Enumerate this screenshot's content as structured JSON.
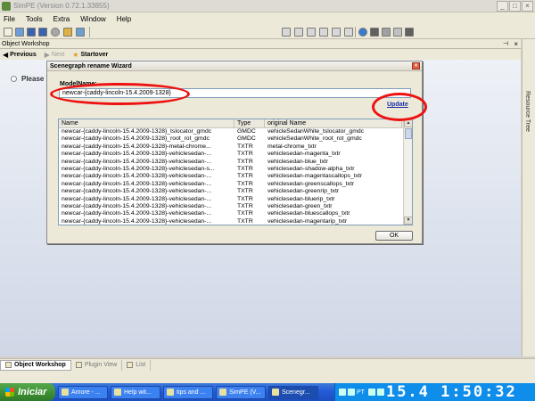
{
  "window": {
    "title": "SimPE (Version 0.72.1.33855)"
  },
  "menu": {
    "items": [
      "File",
      "Tools",
      "Extra",
      "Window",
      "Help"
    ]
  },
  "object_workshop": {
    "title": "Object Workshop",
    "nav": {
      "previous": "Previous",
      "next": "Next",
      "startover": "Startover"
    },
    "prompt": "Please V"
  },
  "side_tab": {
    "label": "Resource Tree"
  },
  "dialog": {
    "title": "Scenegraph rename Wizard",
    "model_name_label": "ModelName:",
    "model_name_value": "newcar-{caddy-lincoln-15.4.2009-1328}",
    "update_link": "Update",
    "ok_button": "OK",
    "columns": [
      "Name",
      "Type",
      "original Name"
    ],
    "rows": [
      [
        "newcar-{caddy-lincoln-15.4.2009-1328}_tslocator_gmdc",
        "GMDC",
        "vehicleSedanWhite_tslocator_gmdc"
      ],
      [
        "newcar-{caddy-lincoln-15.4.2009-1328}_root_rot_gmdc",
        "GMDC",
        "vehicleSedanWhite_root_rot_gmdc"
      ],
      [
        "newcar-{caddy-lincoln-15.4.2009-1328}-metal-chrome...",
        "TXTR",
        "metal-chrome_txtr"
      ],
      [
        "newcar-{caddy-lincoln-15.4.2009-1328}-vehiclesedan-...",
        "TXTR",
        "vehiclesedan-magenta_txtr"
      ],
      [
        "newcar-{caddy-lincoln-15.4.2009-1328}-vehiclesedan-...",
        "TXTR",
        "vehiclesedan-blue_txtr"
      ],
      [
        "newcar-{caddy-lincoln-15.4.2009-1328}-vehiclesedan-s...",
        "TXTR",
        "vehiclesedan-shadow-alpha_txtr"
      ],
      [
        "newcar-{caddy-lincoln-15.4.2009-1328}-vehiclesedan-...",
        "TXTR",
        "vehiclesedan-magentascallops_txtr"
      ],
      [
        "newcar-{caddy-lincoln-15.4.2009-1328}-vehiclesedan-...",
        "TXTR",
        "vehiclesedan-greenscallops_txtr"
      ],
      [
        "newcar-{caddy-lincoln-15.4.2009-1328}-vehiclesedan-...",
        "TXTR",
        "vehiclesedan-greenrip_txtr"
      ],
      [
        "newcar-{caddy-lincoln-15.4.2009-1328}-vehiclesedan-...",
        "TXTR",
        "vehiclesedan-bluerip_txtr"
      ],
      [
        "newcar-{caddy-lincoln-15.4.2009-1328}-vehiclesedan-...",
        "TXTR",
        "vehiclesedan-green_txtr"
      ],
      [
        "newcar-{caddy-lincoln-15.4.2009-1328}-vehiclesedan-...",
        "TXTR",
        "vehiclesedan-bluescallops_txtr"
      ],
      [
        "newcar-{caddy-lincoln-15.4.2009-1328}-vehiclesedan-...",
        "TXTR",
        "vehiclesedan-magentarip_txtr"
      ]
    ]
  },
  "bottom_tabs": [
    "Object Workshop",
    "Plugin View",
    "List"
  ],
  "taskbar": {
    "start": "Iniciar",
    "buttons": [
      "Amore - ...",
      "Help wit...",
      "tips and ...",
      "SimPE (V...",
      "Scenegr..."
    ],
    "lang": "PT",
    "clock": "15.4 1:50:32"
  },
  "colors": {
    "annotation": "#e11111",
    "taskbar": "#245edb",
    "link": "#1a2ea8"
  }
}
